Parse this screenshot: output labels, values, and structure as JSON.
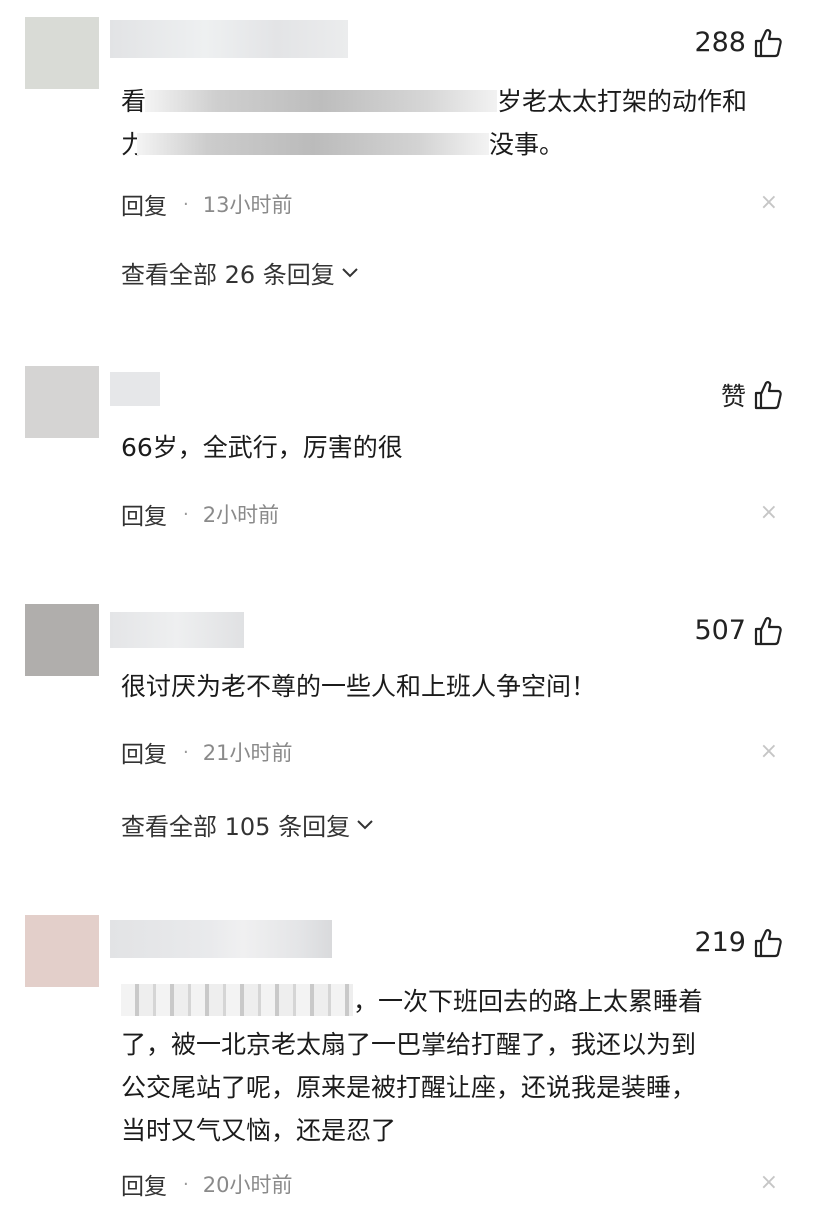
{
  "colors": {
    "avatar_1": "#d9dbd6",
    "avatar_2": "#d5d4d3",
    "avatar_3": "#b0aeac",
    "avatar_4": "#e3cfca",
    "name_blur": "#e5e6e8"
  },
  "icons": {
    "like": "thumbs-up-icon",
    "close": "close-icon",
    "expand": "chevron-down-icon"
  },
  "comments": [
    {
      "likes": "288",
      "text_line1_start": "看",
      "text_line1_end": "岁老太太打架的动作和",
      "text_line2_start": "力",
      "text_line2_end": "没事。",
      "reply_label": "回复",
      "separator": "·",
      "time": "13小时前",
      "close_glyph": "×",
      "view_all": "查看全部 26 条回复"
    },
    {
      "likes": "赞",
      "text": "66岁，全武行，厉害的很",
      "reply_label": "回复",
      "separator": "·",
      "time": "2小时前",
      "close_glyph": "×"
    },
    {
      "likes": "507",
      "text": "很讨厌为老不尊的一些人和上班人争空间！",
      "reply_label": "回复",
      "separator": "·",
      "time": "21小时前",
      "close_glyph": "×",
      "view_all": "查看全部 105 条回复"
    },
    {
      "likes": "219",
      "text_line1_end": "，一次下班回去的路上太累睡着",
      "text_line2": "了，被一北京老太扇了一巴掌给打醒了，我还以为到",
      "text_line3": "公交尾站了呢，原来是被打醒让座，还说我是装睡，",
      "text_line4": "当时又气又恼，还是忍了",
      "reply_label": "回复",
      "separator": "·",
      "time": "20小时前",
      "close_glyph": "×"
    }
  ]
}
